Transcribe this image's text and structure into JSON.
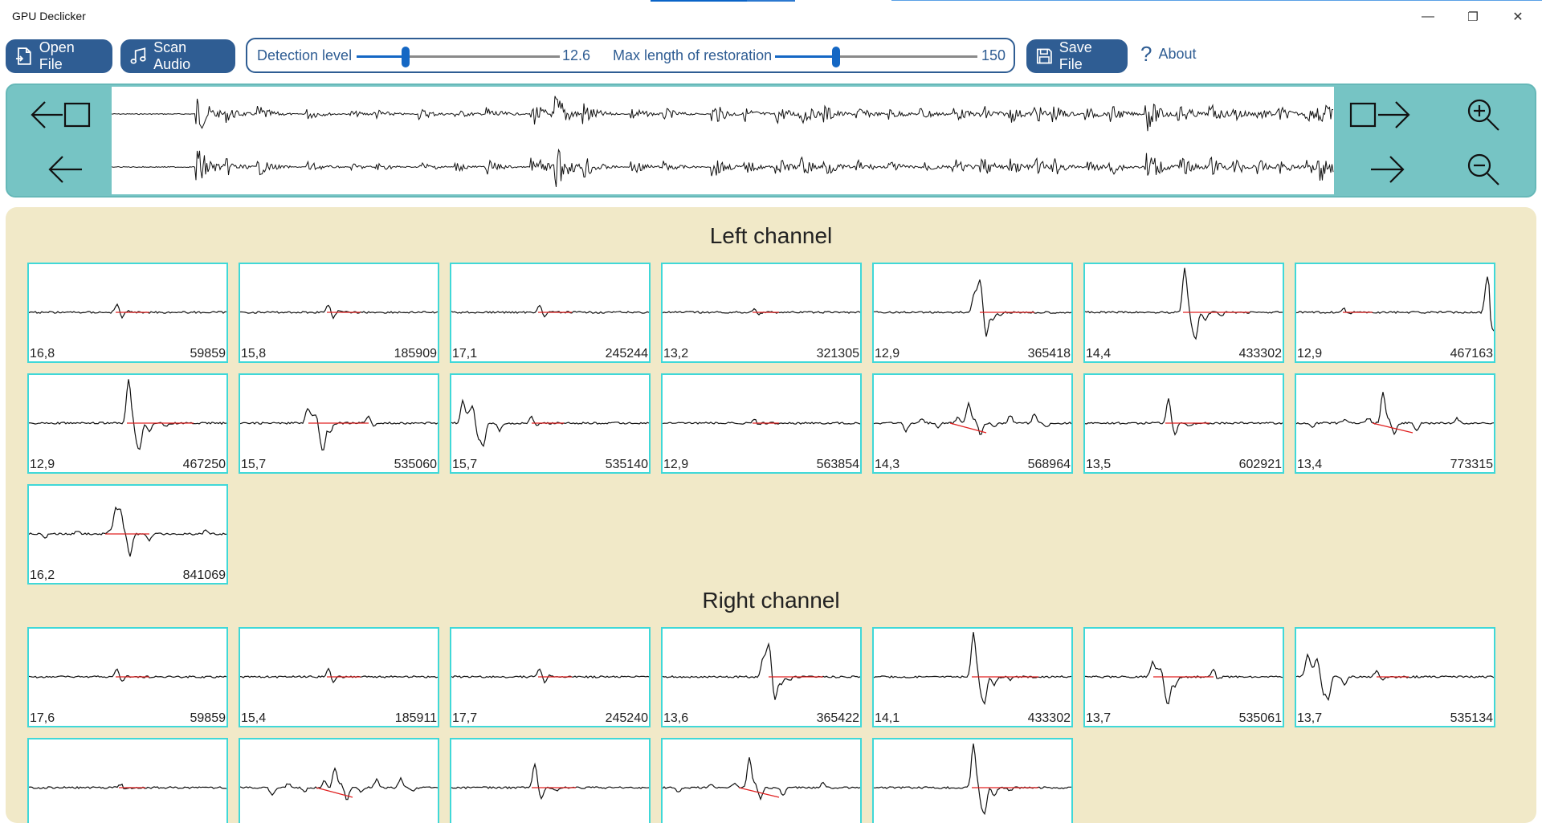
{
  "window": {
    "title": "GPU Declicker",
    "minimize": "—",
    "maximize": "❐",
    "close": "✕"
  },
  "toolbar": {
    "open_label": "Open File",
    "scan_label": "Scan Audio",
    "detection_label": "Detection level",
    "detection_value": "12.6",
    "detection_fraction": 0.24,
    "maxlen_label": "Max length of restoration",
    "maxlen_value": "150",
    "maxlen_fraction": 0.3,
    "save_label": "Save File",
    "about_label": "About",
    "about_icon": "?"
  },
  "overview": {
    "icons": [
      "page-left-icon",
      "step-left-icon",
      "page-right-icon",
      "step-right-icon",
      "zoom-in-icon",
      "zoom-out-icon"
    ]
  },
  "left": {
    "title": "Left channel",
    "clicks": [
      {
        "level": "16,8",
        "pos": "59859",
        "shape": 0
      },
      {
        "level": "15,8",
        "pos": "185909",
        "shape": 0
      },
      {
        "level": "17,1",
        "pos": "245244",
        "shape": 0
      },
      {
        "level": "13,2",
        "pos": "321305",
        "shape": 1
      },
      {
        "level": "12,9",
        "pos": "365418",
        "shape": 2
      },
      {
        "level": "14,4",
        "pos": "433302",
        "shape": 3
      },
      {
        "level": "12,9",
        "pos": "467163",
        "shape": 4
      },
      {
        "level": "12,9",
        "pos": "467250",
        "shape": 3
      },
      {
        "level": "15,7",
        "pos": "535060",
        "shape": 5
      },
      {
        "level": "15,7",
        "pos": "535140",
        "shape": 6
      },
      {
        "level": "12,9",
        "pos": "563854",
        "shape": 1
      },
      {
        "level": "14,3",
        "pos": "568964",
        "shape": 7
      },
      {
        "level": "13,5",
        "pos": "602921",
        "shape": 8
      },
      {
        "level": "13,4",
        "pos": "773315",
        "shape": 9
      },
      {
        "level": "16,2",
        "pos": "841069",
        "shape": 10
      }
    ]
  },
  "right": {
    "title": "Right channel",
    "clicks": [
      {
        "level": "17,6",
        "pos": "59859",
        "shape": 0
      },
      {
        "level": "15,4",
        "pos": "185911",
        "shape": 0
      },
      {
        "level": "17,7",
        "pos": "245240",
        "shape": 0
      },
      {
        "level": "13,6",
        "pos": "365422",
        "shape": 2
      },
      {
        "level": "14,1",
        "pos": "433302",
        "shape": 3
      },
      {
        "level": "13,7",
        "pos": "535061",
        "shape": 5
      },
      {
        "level": "13,7",
        "pos": "535134",
        "shape": 6
      },
      {
        "level": "",
        "pos": "",
        "shape": 1
      },
      {
        "level": "",
        "pos": "",
        "shape": 7
      },
      {
        "level": "",
        "pos": "",
        "shape": 8
      },
      {
        "level": "",
        "pos": "",
        "shape": 9
      },
      {
        "level": "",
        "pos": "",
        "shape": 3
      }
    ]
  },
  "colors": {
    "accent": "#2f5d93",
    "teal": "#76c4c4",
    "panel": "#f1e9c8",
    "thumb_border": "#40d8d8",
    "marker": "#e02020"
  }
}
